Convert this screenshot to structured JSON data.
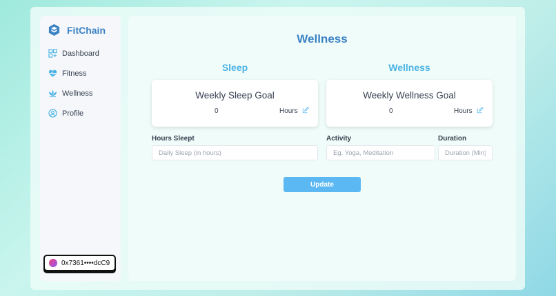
{
  "app": {
    "brand": "FitChain",
    "accent": "#3b82c4",
    "secondary_accent": "#4ab3e6",
    "button_color": "#5bb8f2"
  },
  "sidebar": {
    "items": [
      {
        "label": "Dashboard",
        "icon": "dashboard-icon"
      },
      {
        "label": "Fitness",
        "icon": "heart-pulse-icon"
      },
      {
        "label": "Wellness",
        "icon": "lotus-icon"
      },
      {
        "label": "Profile",
        "icon": "user-circle-icon"
      }
    ],
    "wallet": {
      "address": "0x7361••••dcC9",
      "icon": "wallet-avatar-icon"
    }
  },
  "main": {
    "title": "Wellness",
    "sleep": {
      "section_title": "Sleep",
      "card_title": "Weekly Sleep Goal",
      "value": "0",
      "unit": "Hours",
      "edit_icon": "edit-icon"
    },
    "wellness": {
      "section_title": "Wellness",
      "card_title": "Weekly Wellness Goal",
      "value": "0",
      "unit": "Hours",
      "edit_icon": "edit-icon"
    },
    "form": {
      "hours_label": "Hours Sleept",
      "hours_placeholder": "Daily Sleep (in hours)",
      "hours_value": "",
      "activity_label": "Activity",
      "activity_placeholder": "Eg. Yoga, Meditation",
      "activity_value": "",
      "duration_label": "Duration",
      "duration_placeholder": "Duration (Min)",
      "duration_value": "",
      "submit_label": "Update"
    }
  }
}
